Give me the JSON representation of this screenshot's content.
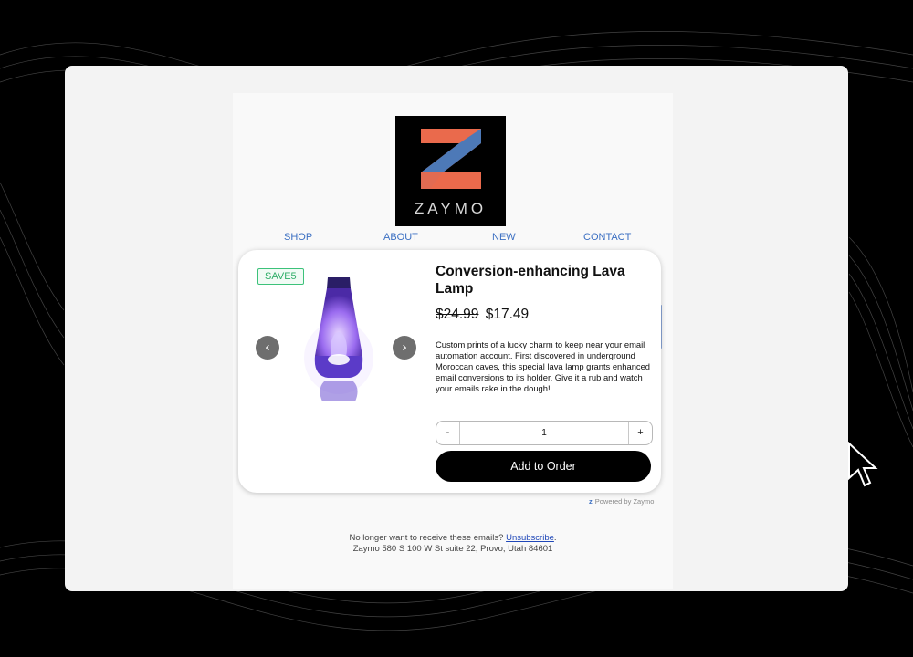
{
  "logo": {
    "wordmark": "ZAYMO"
  },
  "nav": [
    "SHOP",
    "ABOUT",
    "NEW",
    "CONTACT"
  ],
  "product": {
    "badge": "SAVE5",
    "title": "Conversion-enhancing Lava Lamp",
    "old_price": "$24.99",
    "price": "$17.49",
    "description": "Custom prints of a lucky charm to keep near your email automation account. First discovered in underground Moroccan caves, this special lava lamp grants enhanced email conversions to its holder. Give it a rub and watch your emails rake in the dough!",
    "quantity": "1",
    "minus_label": "-",
    "plus_label": "+",
    "prev_icon": "‹",
    "next_icon": "›",
    "add_button": "Add to Order"
  },
  "powered_by": "Powered by Zaymo",
  "footer": {
    "text_before": "No longer want to receive these emails?",
    "unsubscribe": "Unsubscribe",
    "text_after": ".",
    "address": "Zaymo 580 S 100 W St suite 22, Provo, Utah 84601"
  },
  "colors": {
    "accent": "#3b6fc2",
    "badge_green": "#2fae68",
    "button_black": "#000000"
  }
}
